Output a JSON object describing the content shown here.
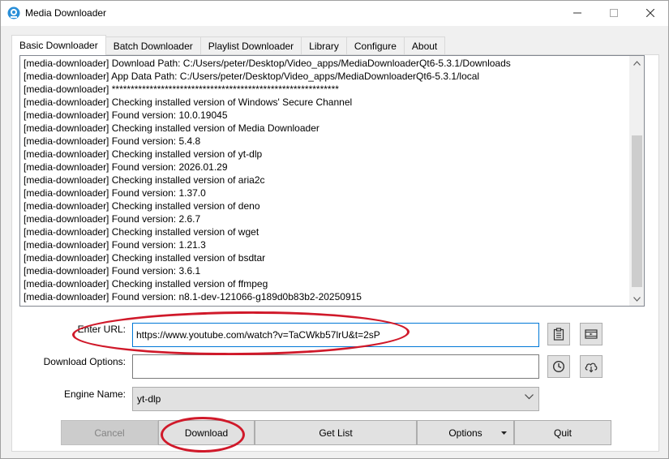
{
  "window": {
    "title": "Media Downloader"
  },
  "tabs": [
    {
      "label": "Basic Downloader"
    },
    {
      "label": "Batch Downloader"
    },
    {
      "label": "Playlist Downloader"
    },
    {
      "label": "Library"
    },
    {
      "label": "Configure"
    },
    {
      "label": "About"
    }
  ],
  "log": [
    "[media-downloader] Download Path: C:/Users/peter/Desktop/Video_apps/MediaDownloaderQt6-5.3.1/Downloads",
    "[media-downloader] App Data Path: C:/Users/peter/Desktop/Video_apps/MediaDownloaderQt6-5.3.1/local",
    "[media-downloader] ************************************************************",
    "[media-downloader] Checking installed version of Windows' Secure Channel",
    "[media-downloader] Found version: 10.0.19045",
    "[media-downloader] Checking installed version of Media Downloader",
    "[media-downloader] Found version: 5.4.8",
    "[media-downloader] Checking installed version of yt-dlp",
    "[media-downloader] Found version: 2026.01.29",
    "[media-downloader] Checking installed version of aria2c",
    "[media-downloader] Found version: 1.37.0",
    "[media-downloader] Checking installed version of deno",
    "[media-downloader] Found version: 2.6.7",
    "[media-downloader] Checking installed version of wget",
    "[media-downloader] Found version: 1.21.3",
    "[media-downloader] Checking installed version of bsdtar",
    "[media-downloader] Found version: 3.6.1",
    "[media-downloader] Checking installed version of ffmpeg",
    "[media-downloader] Found version: n8.1-dev-121066-g189d0b83b2-20250915"
  ],
  "form": {
    "url_label": "Enter URL:",
    "url_value": "https://www.youtube.com/watch?v=TaCWkb57lrU&t=2sP",
    "options_label": "Download Options:",
    "options_value": "",
    "engine_label": "Engine Name:",
    "engine_value": "yt-dlp"
  },
  "buttons": {
    "cancel": "Cancel",
    "download": "Download",
    "get_list": "Get List",
    "options": "Options",
    "quit": "Quit"
  },
  "icons": {
    "paste": "clipboard-icon",
    "media": "film-icon",
    "history": "clock-icon",
    "cloud": "cloud-download-icon"
  },
  "colors": {
    "annotation": "#d0192a",
    "focus": "#0078d7"
  }
}
